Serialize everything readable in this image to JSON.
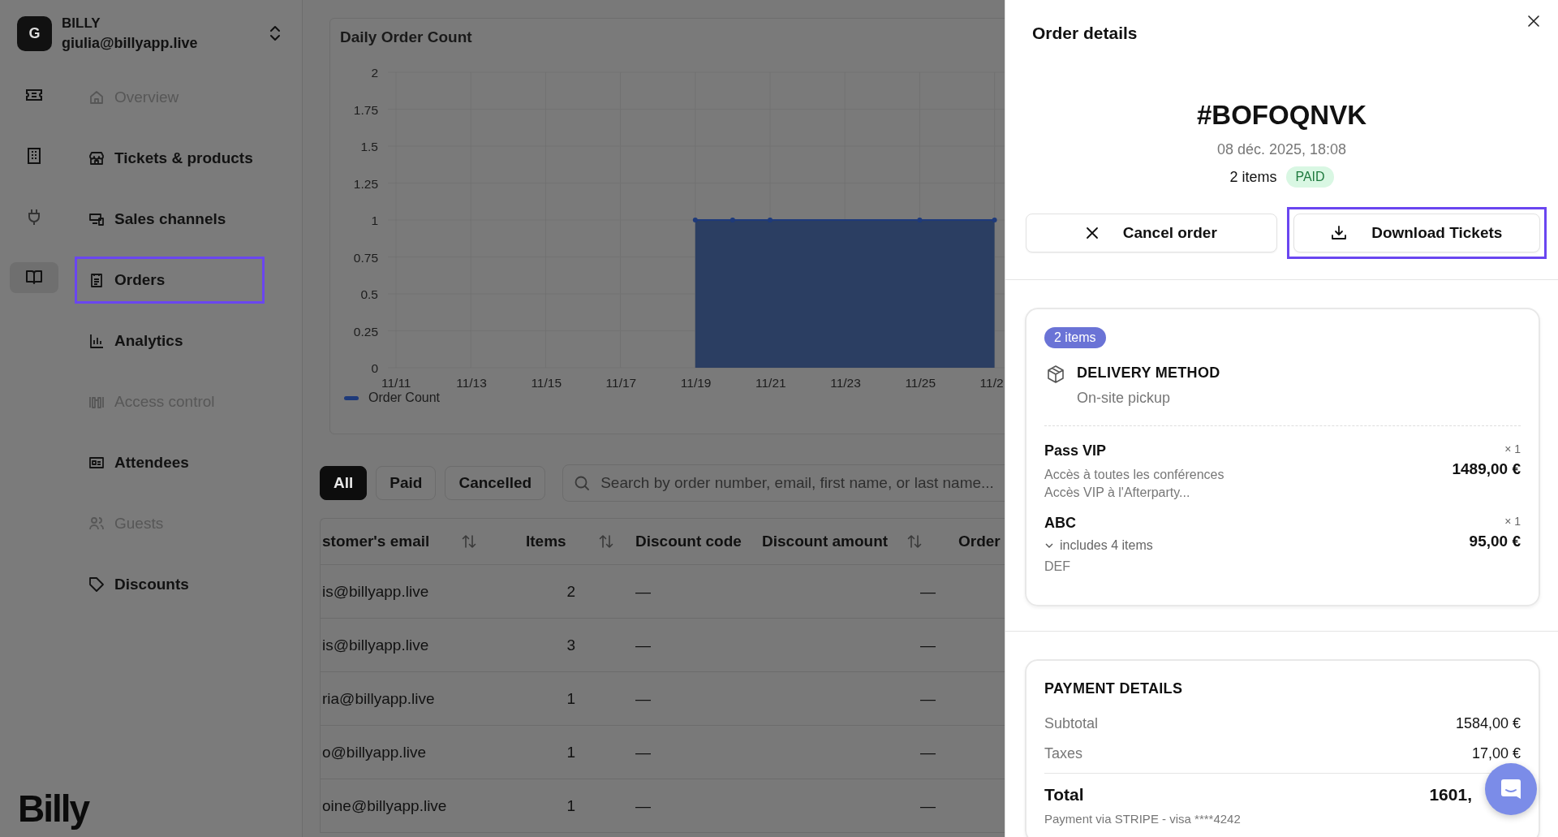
{
  "sidebar": {
    "account": {
      "avatar": "G",
      "name": "BILLY",
      "email": "giulia@billyapp.live"
    },
    "rail": [
      {
        "selected": false
      },
      {
        "selected": false
      },
      {
        "selected": false
      },
      {
        "selected": true
      }
    ],
    "nav": [
      {
        "label": "Overview",
        "disabled": true,
        "selected": false
      },
      {
        "label": "Tickets & products",
        "disabled": false,
        "selected": false
      },
      {
        "label": "Sales channels",
        "disabled": false,
        "selected": false
      },
      {
        "label": "Orders",
        "disabled": false,
        "selected": true
      },
      {
        "label": "Analytics",
        "disabled": false,
        "selected": false
      },
      {
        "label": "Access control",
        "disabled": true,
        "selected": false
      },
      {
        "label": "Attendees",
        "disabled": false,
        "selected": false
      },
      {
        "label": "Guests",
        "disabled": true,
        "selected": false
      },
      {
        "label": "Discounts",
        "disabled": false,
        "selected": false
      }
    ],
    "logo": "Billy"
  },
  "main": {
    "chart": {
      "title": "Daily Order Count",
      "chart_data": {
        "type": "area",
        "categories": [
          "11/11",
          null,
          "11/13",
          null,
          "11/15",
          null,
          "11/17",
          null,
          "11/19",
          null,
          "11/21",
          null,
          "11/23",
          null,
          "11/25",
          null,
          "11/2",
          null
        ],
        "series": [
          {
            "name": "Order Count",
            "color": "#1e3a7a",
            "values": [
              null,
              null,
              null,
              null,
              null,
              null,
              null,
              null,
              1,
              1,
              1,
              null,
              null,
              null,
              1,
              null,
              1,
              null
            ]
          }
        ],
        "grid": true,
        "ylim": [
          0,
          2
        ],
        "yticks": [
          0,
          0.25,
          0.5,
          0.75,
          1,
          1.25,
          1.5,
          1.75,
          2
        ]
      }
    },
    "filters": [
      {
        "label": "All",
        "selected": true
      },
      {
        "label": "Paid",
        "selected": false
      },
      {
        "label": "Cancelled",
        "selected": false
      }
    ],
    "search": {
      "placeholder": "Search by order number, email, first name, or last name..."
    },
    "table": {
      "columns": [
        {
          "label": "stomer's email",
          "sortable": true
        },
        {
          "label": "Items",
          "sortable": true
        },
        {
          "label": "Discount code",
          "sortable": false
        },
        {
          "label": "Discount amount",
          "sortable": true
        },
        {
          "label": "Order"
        }
      ],
      "rows": [
        [
          "is@billyapp.live",
          "2",
          "—",
          "—"
        ],
        [
          "is@billyapp.live",
          "3",
          "—",
          "—"
        ],
        [
          "ria@billyapp.live",
          "1",
          "—",
          "—"
        ],
        [
          "o@billyapp.live",
          "1",
          "—",
          "—"
        ],
        [
          "oine@billyapp.live",
          "1",
          "—",
          "—"
        ]
      ]
    }
  },
  "drawer": {
    "title": "Order details",
    "order_number": "#BOFOQNVK",
    "date": "08 déc. 2025, 18:08",
    "item_count": "2 items",
    "status": "PAID",
    "actions": [
      {
        "label": "Cancel order",
        "highlighted": false
      },
      {
        "label": "Download Tickets",
        "highlighted": true
      }
    ],
    "items_card": {
      "badge": "2 items",
      "delivery_title": "DELIVERY METHOD",
      "delivery_value": "On-site pickup",
      "lines": [
        {
          "name": "Pass VIP",
          "quantity": "× 1",
          "price": "1489,00 €",
          "sub": [
            {
              "kind": "text",
              "text": "Accès à toutes les conférences"
            },
            {
              "kind": "text",
              "text": "Accès VIP à l'Afterparty..."
            }
          ]
        },
        {
          "name": "ABC",
          "quantity": "× 1",
          "price": "95,00 €",
          "sub": [
            {
              "kind": "toggle",
              "text": "includes 4 items"
            },
            {
              "kind": "text",
              "text": "DEF"
            }
          ]
        }
      ]
    },
    "payment": {
      "title": "PAYMENT DETAILS",
      "rows": [
        {
          "label": "Subtotal",
          "value": "1584,00 €"
        },
        {
          "label": "Taxes",
          "value": "17,00 €"
        }
      ],
      "total": {
        "label": "Total",
        "value": "1601,"
      },
      "note": "Payment via STRIPE - visa ****4242"
    }
  }
}
